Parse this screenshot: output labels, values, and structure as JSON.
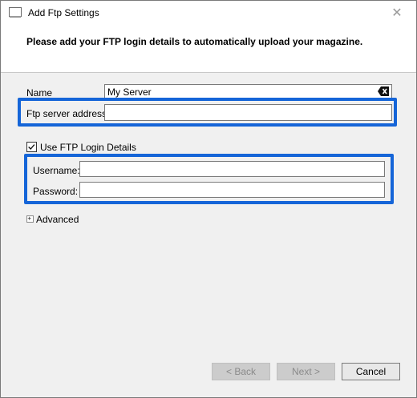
{
  "window": {
    "title": "Add Ftp Settings",
    "close_glyph": "✕"
  },
  "header": {
    "instruction": "Please add your FTP login details to automatically upload your magazine."
  },
  "form": {
    "name_label": "Name",
    "name_value": "My Server",
    "ftp_address_label": "Ftp server address",
    "ftp_address_value": "",
    "use_login_checkbox_label": "Use FTP Login Details",
    "use_login_checked": true,
    "username_label": "Username:",
    "username_value": "",
    "password_label": "Password:",
    "password_value": "",
    "advanced_label": "Advanced"
  },
  "buttons": {
    "back": "< Back",
    "next": "Next >",
    "cancel": "Cancel"
  },
  "colors": {
    "highlight": "#1565d8",
    "window_bg": "#f0f0f0",
    "header_bg": "#ffffff"
  },
  "icons": {
    "app": "window-icon",
    "clear": "backspace-clear-icon",
    "checkbox": "check-icon",
    "expander": "plus-expander-icon",
    "close": "close-icon"
  }
}
